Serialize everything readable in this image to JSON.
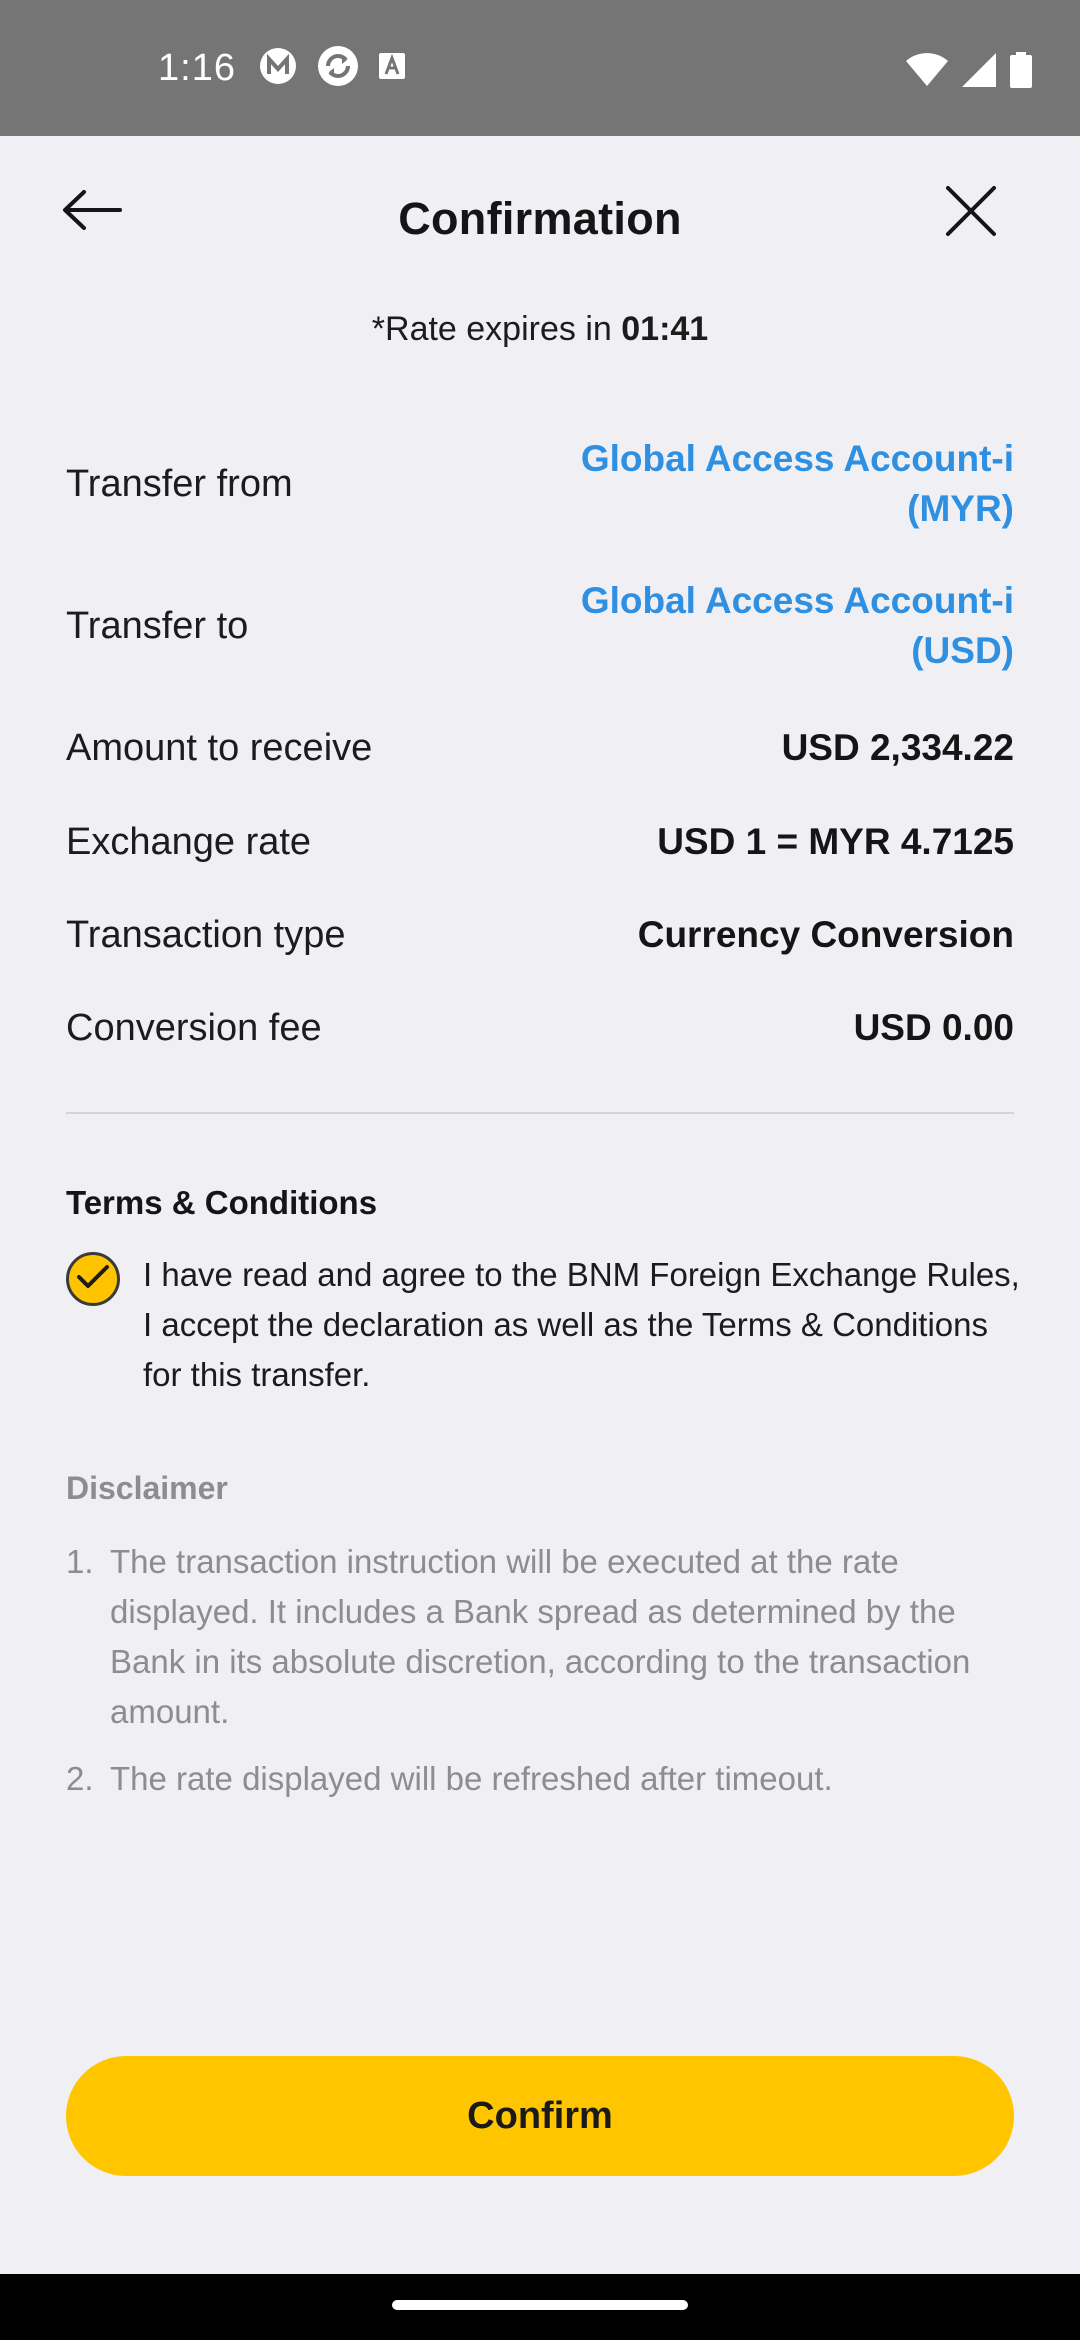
{
  "status_bar": {
    "time": "1:16",
    "icons_left": [
      "m-app-icon",
      "sync-icon",
      "a-text-icon"
    ],
    "icons_right": [
      "wifi-icon",
      "signal-icon",
      "battery-icon"
    ]
  },
  "header": {
    "title": "Confirmation",
    "back_icon": "arrow-left-icon",
    "close_icon": "close-icon"
  },
  "rate_expiry": {
    "prefix": "*Rate expires in ",
    "time": "01:41"
  },
  "details": [
    {
      "label": "Transfer from",
      "value_line1": "Global Access Account-i",
      "value_line2": "(MYR)",
      "link": true
    },
    {
      "label": "Transfer to",
      "value_line1": "Global Access Account-i",
      "value_line2": "(USD)",
      "link": true
    },
    {
      "label": "Amount to receive",
      "value_line1": "USD 2,334.22"
    },
    {
      "label": "Exchange rate",
      "value_line1": "USD 1 = MYR 4.7125"
    },
    {
      "label": "Transaction type",
      "value_line1": "Currency Conversion"
    },
    {
      "label": "Conversion fee",
      "value_line1": "USD 0.00"
    }
  ],
  "terms": {
    "title": "Terms & Conditions",
    "checked": true,
    "text": "I have read and agree to the BNM Foreign Exchange Rules, I accept the declaration as well as the Terms & Conditions for this transfer."
  },
  "disclaimer": {
    "title": "Disclaimer",
    "items": [
      {
        "num": "1.",
        "text": "The transaction instruction will be executed at the rate displayed. It includes a Bank spread as determined by the Bank in its absolute discretion, according to the transaction amount."
      },
      {
        "num": "2.",
        "text": "The rate displayed will be refreshed after timeout."
      }
    ]
  },
  "confirm_button": {
    "label": "Confirm"
  },
  "colors": {
    "accent": "#ffc600",
    "link": "#2f8fe0",
    "background": "#efeff4",
    "status_bar": "#757575"
  }
}
